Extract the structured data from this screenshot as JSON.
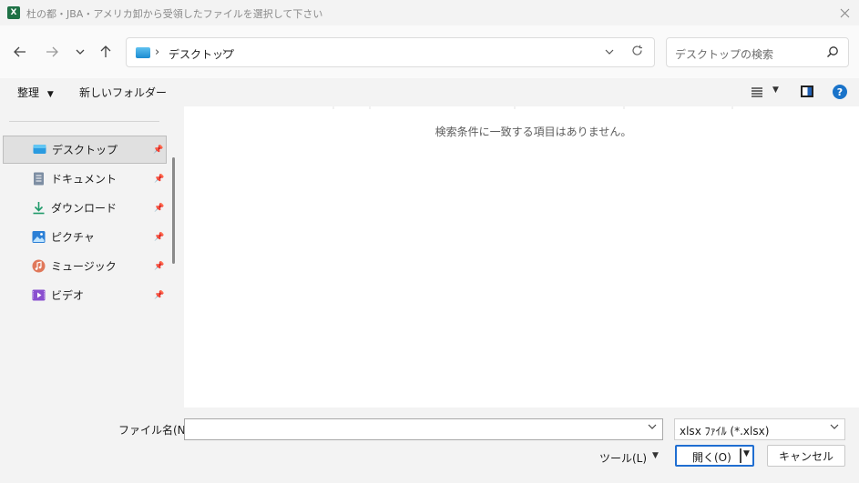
{
  "window": {
    "title": "杜の都・JBA・アメリカ卸から受領したファイルを選択して下さい",
    "app_icon": "excel-icon"
  },
  "nav": {
    "back_icon": "arrow-left-icon",
    "forward_icon": "arrow-right-icon",
    "recent_icon": "chevron-down-icon",
    "up_icon": "arrow-up-icon",
    "address": {
      "location": "デスクトップ",
      "icon": "desktop-icon"
    },
    "search": {
      "placeholder": "デスクトップの検索"
    }
  },
  "commands": {
    "organize": "整理",
    "new_folder": "新しいフォルダー"
  },
  "sidebar": {
    "items": [
      {
        "label": "デスクトップ",
        "icon": "desktop-icon",
        "selected": true
      },
      {
        "label": "ドキュメント",
        "icon": "document-icon"
      },
      {
        "label": "ダウンロード",
        "icon": "download-icon"
      },
      {
        "label": "ピクチャ",
        "icon": "pictures-icon"
      },
      {
        "label": "ミュージック",
        "icon": "music-icon"
      },
      {
        "label": "ビデオ",
        "icon": "video-icon"
      }
    ]
  },
  "main": {
    "empty_message": "検索条件に一致する項目はありません。"
  },
  "footer": {
    "filename_label": "ファイル名(N):",
    "filename_value": "",
    "filetype_selected": "xlsx ﾌｧｲﾙ (*.xlsx)",
    "tools_label": "ツール(L)",
    "open_label": "開く(O)",
    "cancel_label": "キャンセル"
  },
  "colors": {
    "accent": "#1f6ed1",
    "excel_green": "#1e7145",
    "help_blue": "#1a73c9"
  }
}
